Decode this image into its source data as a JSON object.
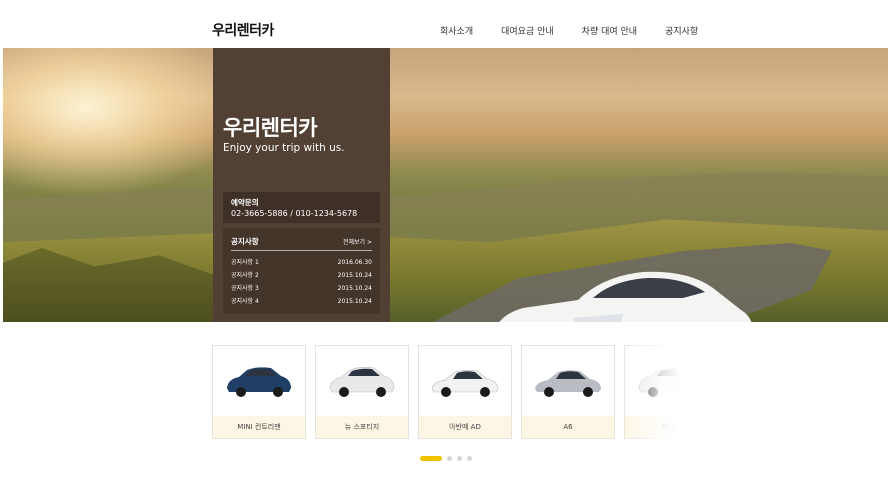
{
  "header": {
    "logo": "우리렌터카",
    "nav": [
      "회사소개",
      "대여요금 안내",
      "차량 대여 안내",
      "공지사항"
    ]
  },
  "hero": {
    "title": "우리렌터카",
    "subtitle": "Enjoy your trip with us.",
    "contact": {
      "label": "예약문의",
      "numbers": "02-3665-5886  /  010-1234-5678"
    },
    "notice": {
      "heading": "공지사항",
      "more": "전체보기 >",
      "items": [
        {
          "title": "공지사항 1",
          "date": "2016.06.30"
        },
        {
          "title": "공지사항 2",
          "date": "2015.10.24"
        },
        {
          "title": "공지사항 3",
          "date": "2015.10.24"
        },
        {
          "title": "공지사항 4",
          "date": "2015.10.24"
        }
      ]
    }
  },
  "cars": [
    {
      "label": "MINI 컨트리맨",
      "color": "#1f3f66"
    },
    {
      "label": "뉴 스포티지",
      "color": "#e9e9ea"
    },
    {
      "label": "아반떼 AD",
      "color": "#f2f2f2"
    },
    {
      "label": "A6",
      "color": "#b9bcc2"
    },
    {
      "label": "카니발",
      "color": "#e8e8e8"
    }
  ],
  "pagination": {
    "total": 4,
    "active": 0
  },
  "colors": {
    "panel": "#524034",
    "accent": "#f2c200",
    "card_label_bg": "#fdf6e4"
  }
}
